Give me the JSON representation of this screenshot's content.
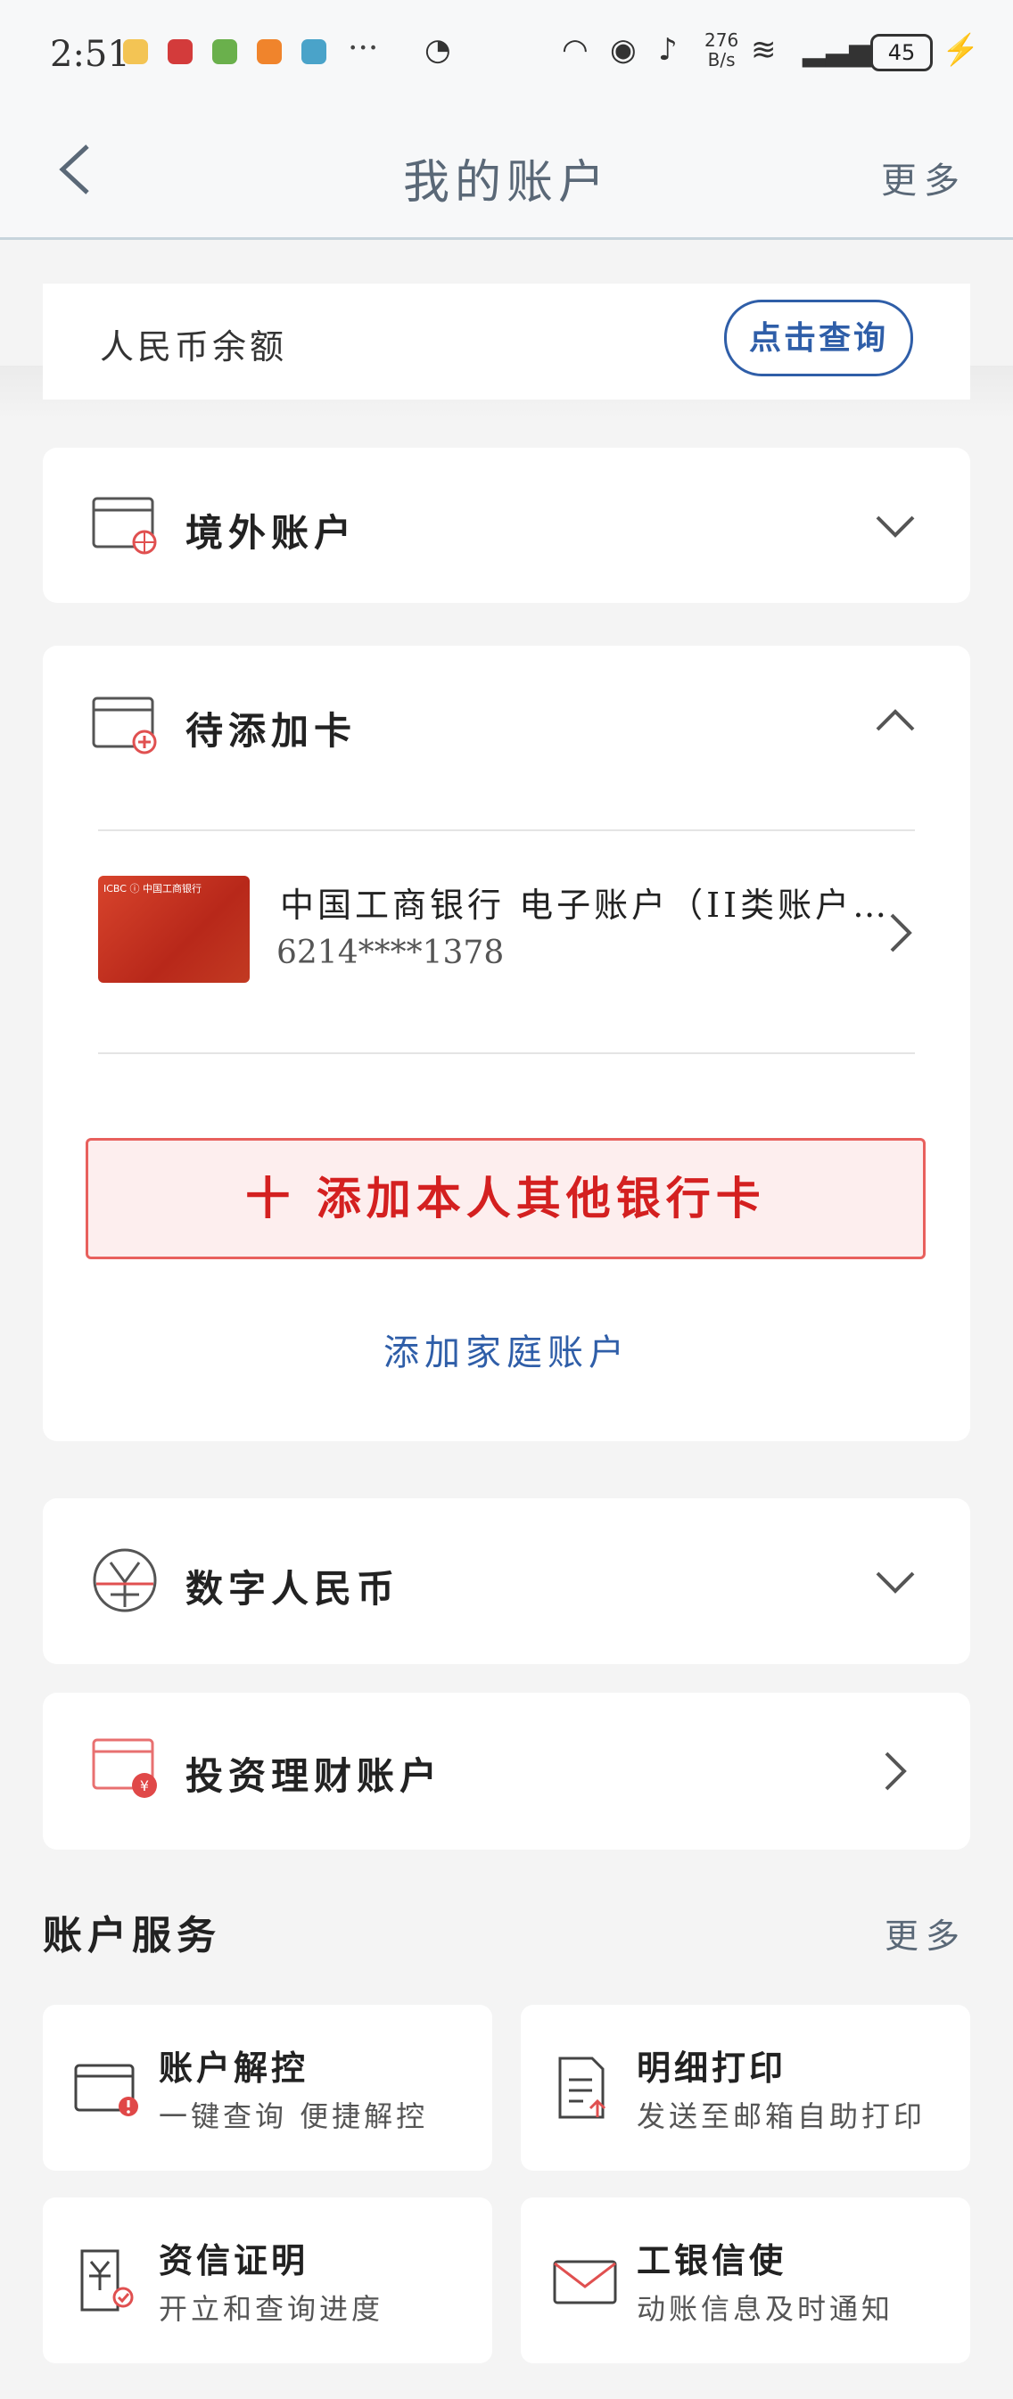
{
  "status_bar": {
    "time": "2:51",
    "more_dots": "···",
    "net_speed_value": "276",
    "net_speed_unit": "B/s",
    "battery": "45"
  },
  "nav": {
    "title": "我的账户",
    "more": "更多"
  },
  "balance": {
    "label": "人民币余额",
    "query_button": "点击查询"
  },
  "overseas": {
    "title": "境外账户"
  },
  "pending": {
    "title": "待添加卡",
    "card": {
      "bank_name": "中国工商银行 电子账户（II类账户…",
      "number": "6214****1378",
      "logo_text": "ICBC ⓘ 中国工商银行"
    },
    "add_other_card": "十 添加本人其他银行卡",
    "add_family": "添加家庭账户"
  },
  "digital_rmb": {
    "title": "数字人民币"
  },
  "investment": {
    "title": "投资理财账户"
  },
  "services": {
    "title": "账户服务",
    "more": "更多",
    "items": [
      {
        "title": "账户解控",
        "subtitle": "一键查询 便捷解控"
      },
      {
        "title": "明细打印",
        "subtitle": "发送至邮箱自助打印"
      },
      {
        "title": "资信证明",
        "subtitle": "开立和查询进度"
      },
      {
        "title": "工银信使",
        "subtitle": "动账信息及时通知"
      }
    ]
  },
  "colors": {
    "accent_blue": "#2f5ea8",
    "accent_red": "#d42020",
    "background": "#f4f4f4"
  }
}
